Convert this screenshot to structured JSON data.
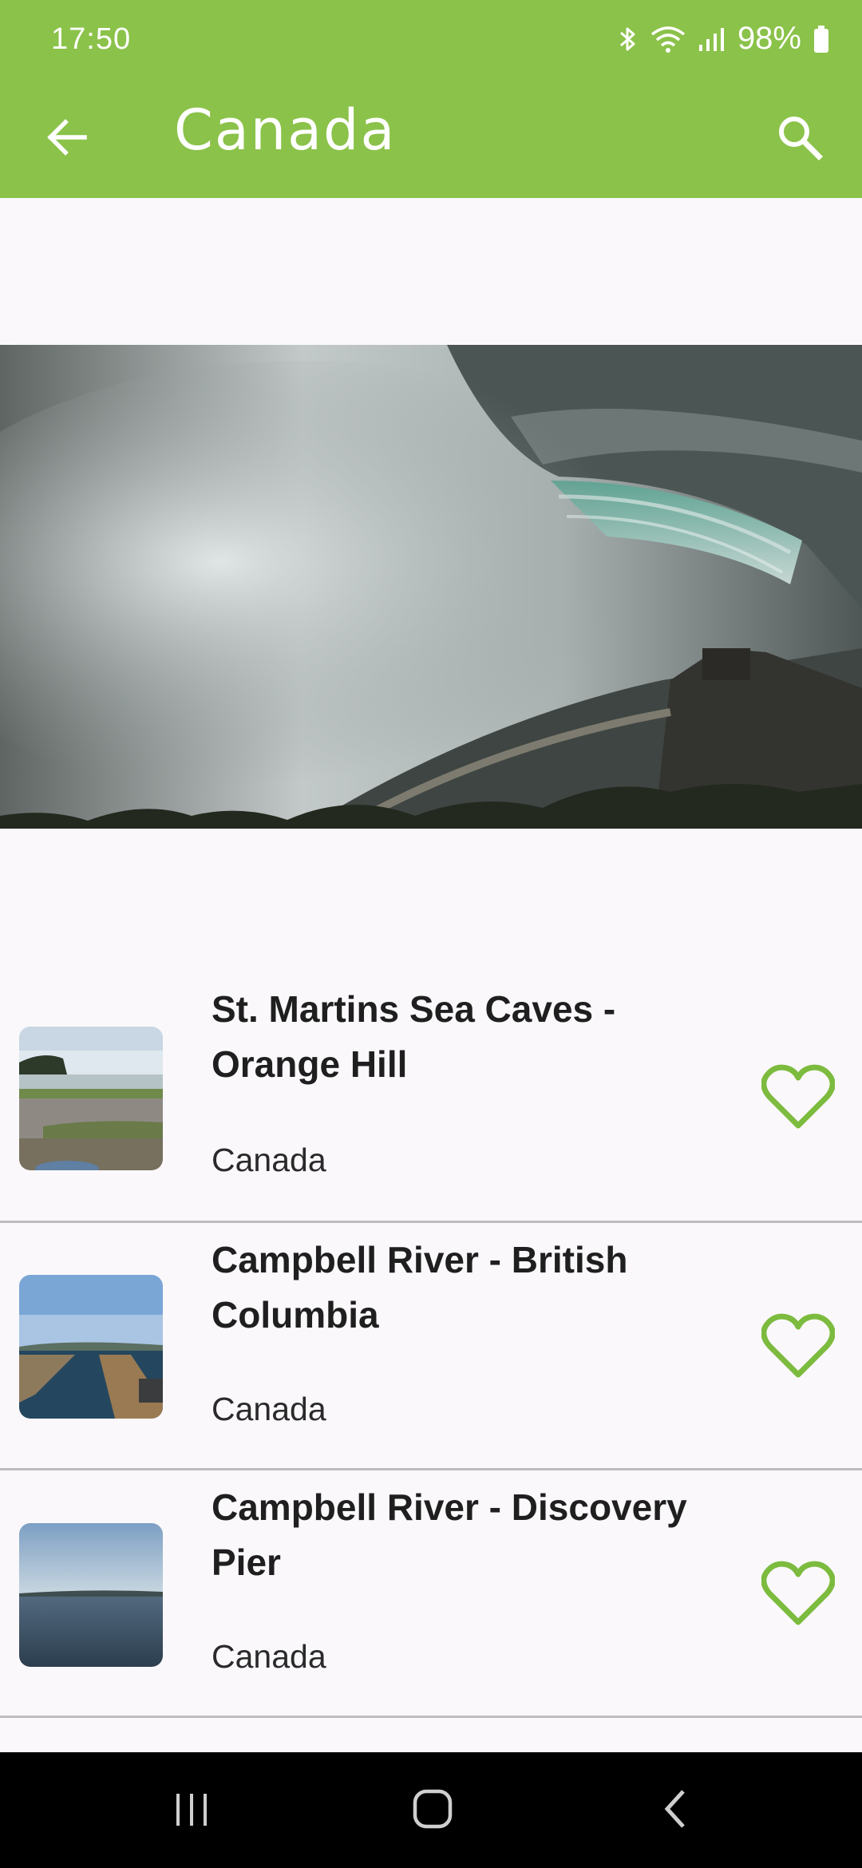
{
  "status_bar": {
    "time": "17:50",
    "battery": "98%",
    "icons": [
      "bluetooth-icon",
      "wifi-icon",
      "signal-icon",
      "battery-icon"
    ]
  },
  "app_bar": {
    "title": "Canada",
    "back_icon": "arrow-left-icon",
    "search_icon": "search-icon"
  },
  "colors": {
    "accent": "#8bc24a",
    "background": "#faf8fb",
    "divider": "#bdbdbd",
    "nav_bar": "#000000"
  },
  "hero": {
    "image": "horseshoe-falls-photo"
  },
  "locations": [
    {
      "title": "St. Martins Sea Caves - Orange Hill",
      "subtitle": "Canada",
      "thumbnail": "sea-caves-beach-photo",
      "favorite": false
    },
    {
      "title": "Campbell River - British Columbia",
      "subtitle": "Canada",
      "thumbnail": "campbell-river-pier-photo",
      "favorite": false
    },
    {
      "title": "Campbell River - Discovery Pier",
      "subtitle": "Canada",
      "thumbnail": "discovery-pier-sea-photo",
      "favorite": false
    }
  ],
  "nav_bar": {
    "buttons": [
      "recent-apps-icon",
      "home-icon",
      "back-icon"
    ]
  }
}
